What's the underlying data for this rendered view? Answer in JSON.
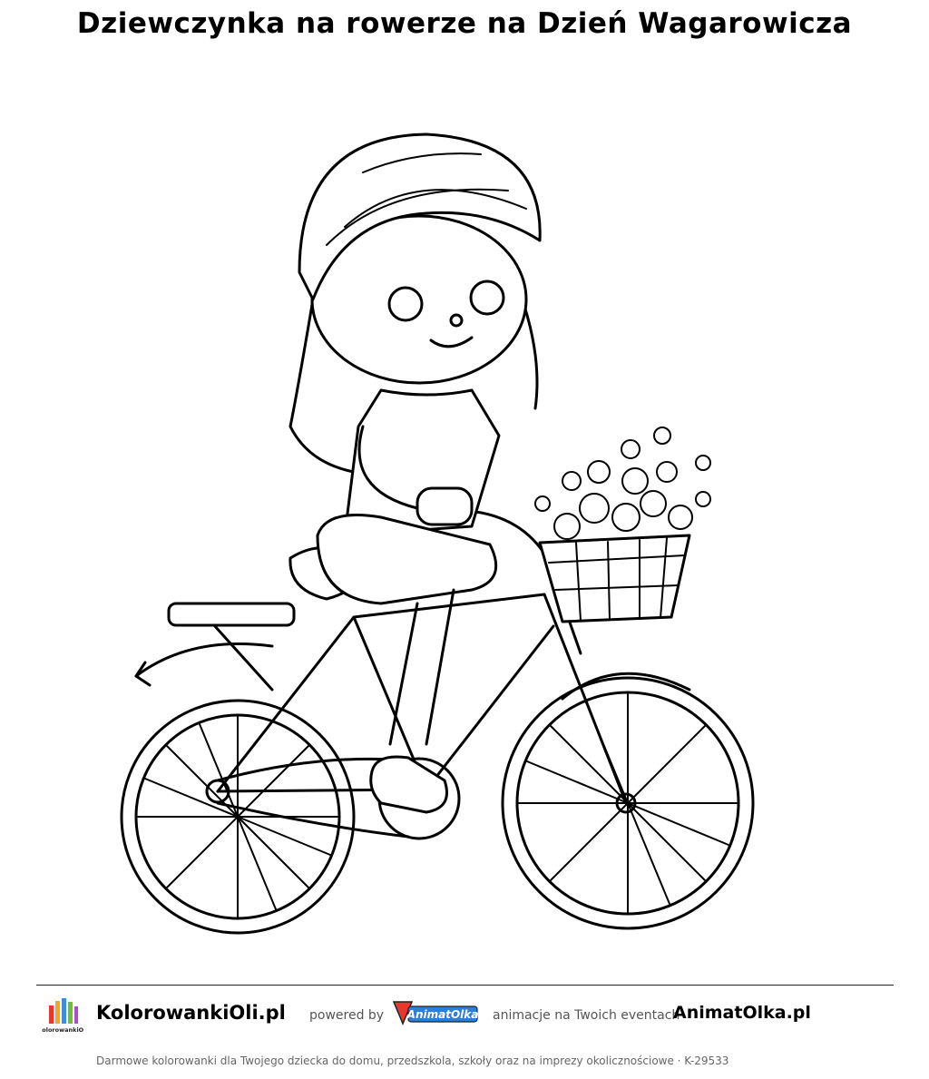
{
  "page": {
    "title": "Dziewczynka na rowerze na Dzień Wagarowicza"
  },
  "illustration": {
    "subject": "girl-on-bicycle-coloring-page"
  },
  "footer": {
    "brand": "KolorowankiOli.pl",
    "logo_text": "KolorowankiOli",
    "powered_by": "powered by",
    "partner_logo_text": "AnimatOlka",
    "tagline": "animacje na Twoich eventach",
    "partner_site": "AnimatOlka.pl",
    "note": "Darmowe kolorowanki dla Twojego dziecka do domu, przedszkola, szkoły oraz na imprezy okolicznościowe  ·  K-29533"
  },
  "colors": {
    "partner_logo_fill": "#2b7fd6",
    "partner_logo_accent": "#e8372c",
    "logo_crayons": [
      "#e8372c",
      "#f5a623",
      "#3b8fd9",
      "#6bbf3a",
      "#b04ad6"
    ]
  }
}
